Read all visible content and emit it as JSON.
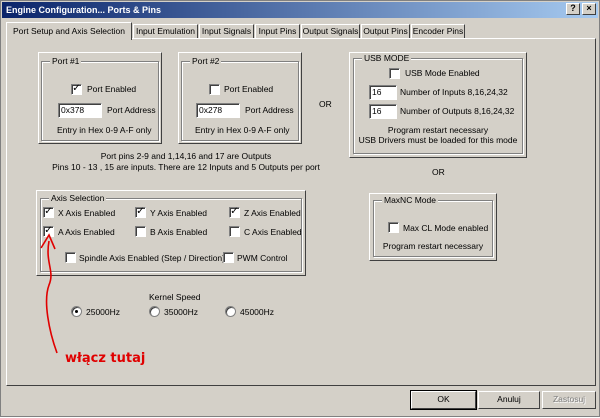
{
  "window": {
    "title": "Engine Configuration... Ports & Pins"
  },
  "tabs": [
    {
      "label": "Port Setup and Axis Selection",
      "active": true
    },
    {
      "label": "Input Emulation"
    },
    {
      "label": "Input Signals"
    },
    {
      "label": "Input Pins"
    },
    {
      "label": "Output Signals"
    },
    {
      "label": "Output Pins"
    },
    {
      "label": "Encoder Pins"
    }
  ],
  "port1": {
    "title": "Port #1",
    "enabled_label": "Port Enabled",
    "enabled": true,
    "address_value": "0x378",
    "address_label": "Port Address",
    "hint": "Entry in Hex 0-9 A-F only"
  },
  "port2": {
    "title": "Port #2",
    "enabled_label": "Port Enabled",
    "enabled": false,
    "address_value": "0x278",
    "address_label": "Port Address",
    "hint": "Entry in Hex 0-9 A-F only"
  },
  "or_label": "OR",
  "usb": {
    "title": "USB MODE",
    "enabled_label": "USB Mode Enabled",
    "enabled": false,
    "inputs_value": "16",
    "inputs_label": "Number of Inputs 8,16,24,32",
    "outputs_value": "16",
    "outputs_label": "Number of Outputs 8,16,24,32",
    "note1": "Program restart necessary",
    "note2": "USB Drivers must be loaded for this mode"
  },
  "port_info": {
    "line1": "Port pins 2-9 and 1,14,16 and 17 are Outputs",
    "line2": "Pins 10 - 13 , 15 are inputs. There are 12 Inputs and 5 Outputs per port"
  },
  "axis": {
    "title": "Axis Selection",
    "x": {
      "label": "X Axis Enabled",
      "checked": true
    },
    "y": {
      "label": "Y Axis Enabled",
      "checked": true
    },
    "z": {
      "label": "Z Axis Enabled",
      "checked": true
    },
    "a": {
      "label": "A Axis Enabled",
      "checked": true
    },
    "b": {
      "label": "B Axis Enabled",
      "checked": false
    },
    "c": {
      "label": "C Axis Enabled",
      "checked": false
    },
    "spindle": {
      "label": "Spindle Axis Enabled (Step / Direction)",
      "checked": false
    },
    "pwm": {
      "label": "PWM Control",
      "checked": false
    }
  },
  "maxnc": {
    "title": "MaxNC Mode",
    "enabled_label": "Max CL Mode enabled",
    "enabled": false,
    "note": "Program restart necessary"
  },
  "kernel": {
    "title": "Kernel Speed",
    "options": [
      "25000Hz",
      "35000Hz",
      "45000Hz"
    ],
    "selected": "25000Hz"
  },
  "annotation": {
    "text": "włącz tutaj",
    "color": "#e00000"
  },
  "buttons": {
    "ok": "OK",
    "cancel": "Anuluj",
    "apply": "Zastosuj"
  },
  "colors": {
    "face": "#d4d0c8",
    "title_start": "#0a246a",
    "title_end": "#a6caf0"
  }
}
